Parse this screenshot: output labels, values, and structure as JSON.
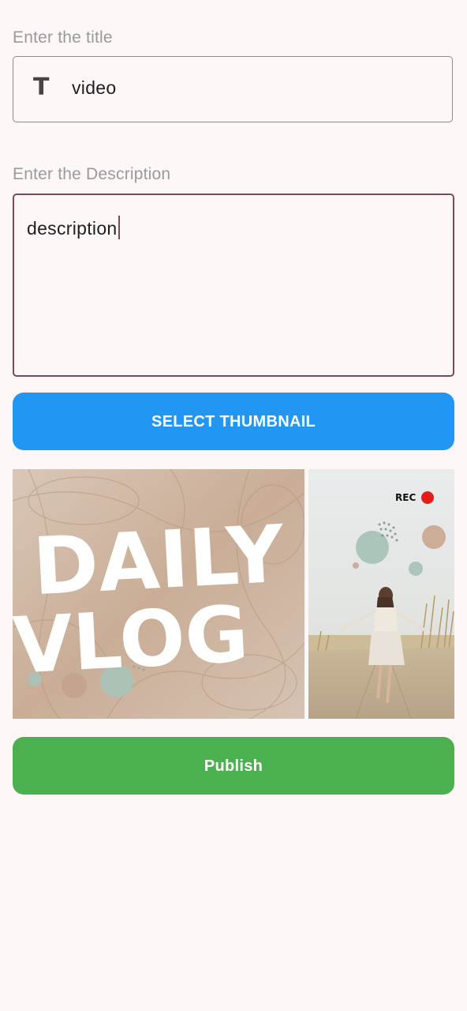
{
  "title_field": {
    "label": "Enter the title",
    "value": "video",
    "icon": "text-format-icon"
  },
  "description_field": {
    "label": "Enter the Description",
    "value": "description"
  },
  "select_thumbnail_button": {
    "label": "SELECT THUMBNAIL",
    "color": "#2196f3"
  },
  "thumbnail_preview": {
    "left_image_text_line1": "DAILY",
    "left_image_text_line2": "VLOG",
    "right_image_badge": "REC"
  },
  "publish_button": {
    "label": "Publish",
    "color": "#4caf50"
  }
}
